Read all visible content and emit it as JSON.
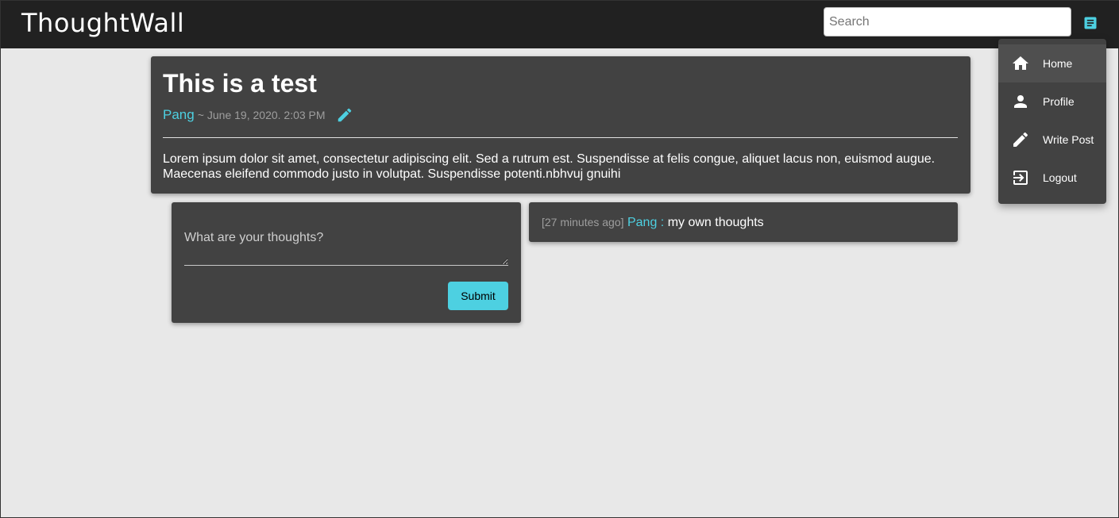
{
  "app": {
    "brand": "ThoughtWall"
  },
  "search": {
    "placeholder": "Search",
    "value": ""
  },
  "icons": {
    "menu": "menu-list-icon",
    "edit": "pencil-icon"
  },
  "colors": {
    "accent": "#4dd0e1",
    "topbar": "#212121",
    "card": "#424242",
    "background": "#e8e8e8"
  },
  "menu": {
    "items": [
      {
        "label": "Home",
        "icon": "home-icon",
        "active": true
      },
      {
        "label": "Profile",
        "icon": "person-icon",
        "active": false
      },
      {
        "label": "Write Post",
        "icon": "pencil-icon",
        "active": false
      },
      {
        "label": "Logout",
        "icon": "logout-icon",
        "active": false
      }
    ]
  },
  "post": {
    "title": "This is a test",
    "author": "Pang",
    "separator": "~",
    "date": "June 19, 2020. 2:03 PM",
    "body": "Lorem ipsum dolor sit amet, consectetur adipiscing elit. Sed a rutrum est. Suspendisse at felis congue, aliquet lacus non, euismod augue. Maecenas eleifend commodo justo in volutpat. Suspendisse potenti.nbhvuj gnuihi"
  },
  "comment_form": {
    "placeholder": "What are your thoughts?",
    "value": "",
    "submit_label": "Submit"
  },
  "thoughts": [
    {
      "time": "[27 minutes ago]",
      "author": "Pang",
      "separator": ":",
      "text": "my own thoughts"
    }
  ]
}
